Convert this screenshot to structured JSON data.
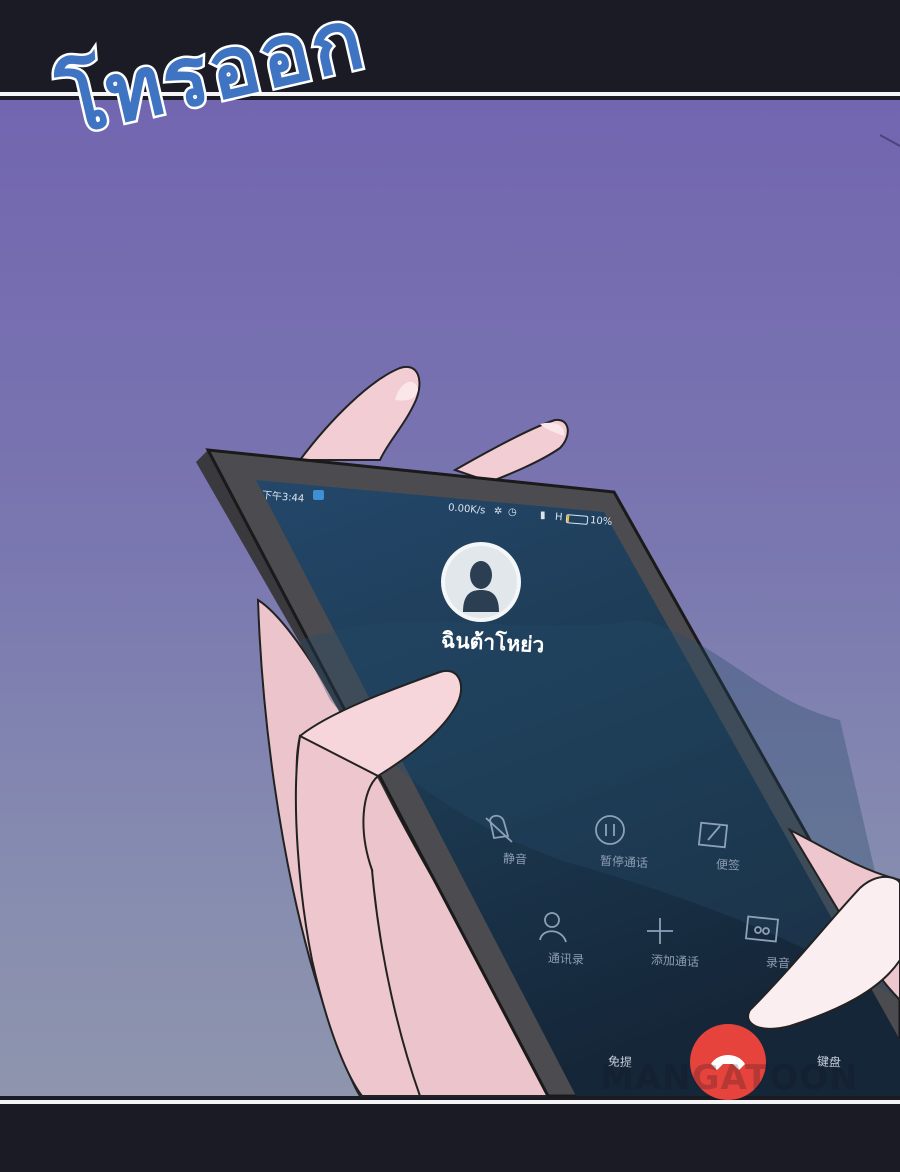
{
  "sfx_text": "โทรออก",
  "phone": {
    "status_time": "下午3:44",
    "status_speed": "0.00K/s",
    "status_network": "H",
    "status_battery": "10%",
    "caller_name": "ฉินต้าโหย่ว",
    "buttons": {
      "mute": "静音",
      "hold": "暂停通话",
      "note": "便签",
      "contacts": "通讯录",
      "add_call": "添加通话",
      "record": "录音",
      "speaker": "免提",
      "keypad": "键盘"
    }
  },
  "watermark": "MANGATOON",
  "colors": {
    "sky_top": "#7266b0",
    "sky_bottom": "#8e95ad",
    "phone_frame": "#4a4a4e",
    "screen": "#1d3850",
    "skin": "#f0cdd2",
    "hangup": "#e5433b",
    "sfx_text": "#3f74c2"
  }
}
